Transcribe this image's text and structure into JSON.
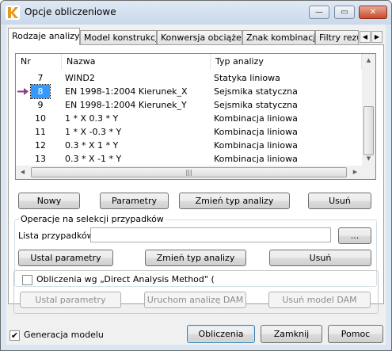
{
  "window": {
    "title": "Opcje obliczeniowe",
    "minimize_glyph": "—",
    "maximize_glyph": "▭",
    "close_glyph": "✕",
    "accent": "#3399ff"
  },
  "tabs": [
    {
      "label": "Rodzaje analizy"
    },
    {
      "label": "Model konstrukcji"
    },
    {
      "label": "Konwersja obciążeń"
    },
    {
      "label": "Znak kombinacji"
    },
    {
      "label": "Filtry rezulta"
    }
  ],
  "tab_scroll": {
    "left": "◀",
    "right": "▶"
  },
  "table": {
    "headers": {
      "nr": "Nr",
      "name": "Nazwa",
      "type": "Typ analizy"
    },
    "rows": [
      {
        "nr": "7",
        "name": "WIND2",
        "type": "Statyka liniowa"
      },
      {
        "nr": "8",
        "name": "EN 1998-1:2004 Kierunek_X",
        "type": "Sejsmika statyczna",
        "selected": true
      },
      {
        "nr": "9",
        "name": "EN 1998-1:2004 Kierunek_Y",
        "type": "Sejsmika statyczna"
      },
      {
        "nr": "10",
        "name": "1 * X  0.3 * Y",
        "type": "Kombinacja liniowa"
      },
      {
        "nr": "11",
        "name": "1 * X  -0.3 * Y",
        "type": "Kombinacja liniowa"
      },
      {
        "nr": "12",
        "name": "0.3 * X  1 * Y",
        "type": "Kombinacja liniowa"
      },
      {
        "nr": "13",
        "name": "0.3 * X  -1 * Y",
        "type": "Kombinacja liniowa"
      }
    ],
    "scroll_up": "▲",
    "scroll_down": "▼",
    "scroll_left": "◀",
    "scroll_right": "▶",
    "grip": "|||"
  },
  "buttons": {
    "new": "Nowy",
    "params": "Parametry",
    "change_type": "Zmień typ analizy",
    "delete": "Usuń"
  },
  "selection_ops": {
    "legend": "Operacje na selekcji przypadków",
    "list_label": "Lista przypadków",
    "list_value": "",
    "browse": "...",
    "set_params": "Ustal parametry",
    "change_type": "Zmień typ analizy",
    "delete": "Usuń"
  },
  "dam": {
    "checkbox_label": "Obliczenia wg „Direct Analysis Method\" (",
    "checked": false,
    "set_params": "Ustal parametry",
    "run": "Uruchom analizę DAM",
    "delete_model": "Usuń model DAM"
  },
  "footer": {
    "model_gen_label": "Generacja modelu",
    "model_gen_checked": true,
    "check_glyph": "✔",
    "calculate": "Obliczenia",
    "close": "Zamknij",
    "help": "Pomoc"
  }
}
